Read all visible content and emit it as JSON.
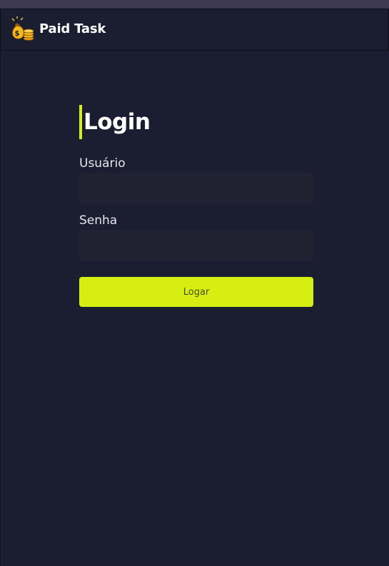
{
  "header": {
    "brand": "Paid Task",
    "logo_icon": "money-bag-icon"
  },
  "login": {
    "title": "Login",
    "username_label": "Usuário",
    "username_value": "",
    "password_label": "Senha",
    "password_value": "",
    "submit_label": "Logar"
  },
  "colors": {
    "background": "#1b1d31",
    "accent": "#d6ee12",
    "input_bg": "#202232"
  }
}
